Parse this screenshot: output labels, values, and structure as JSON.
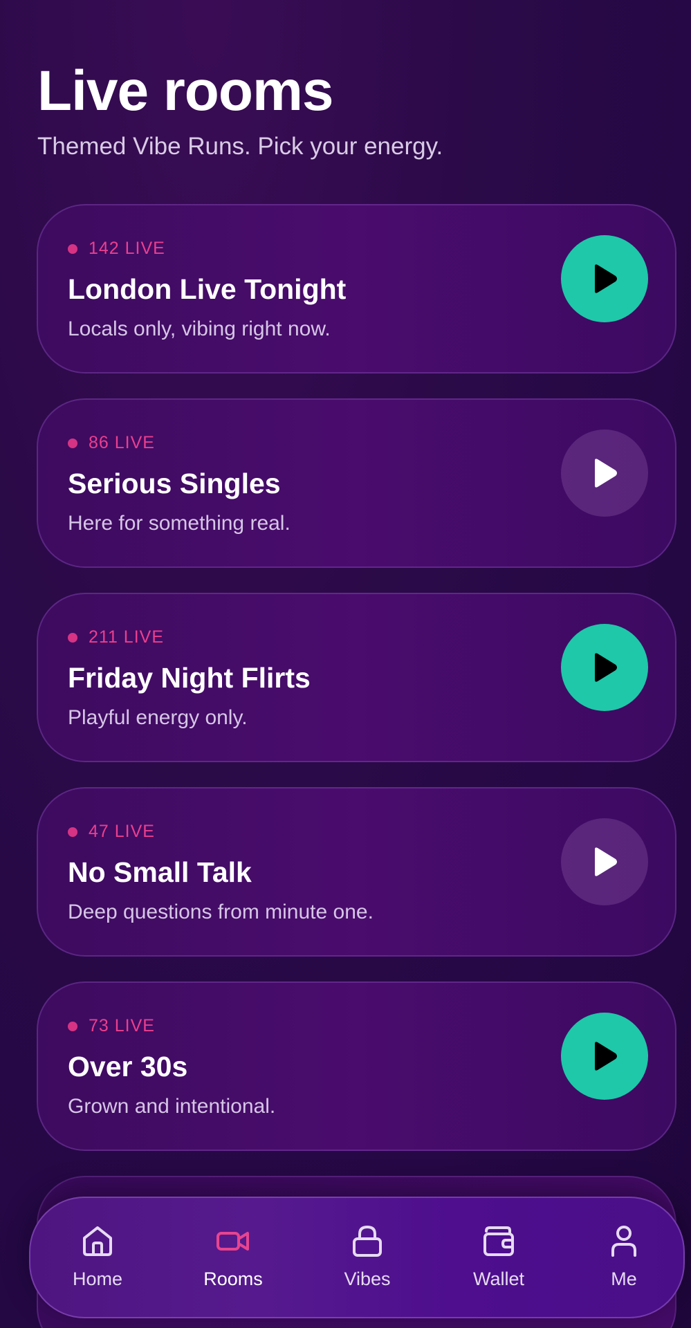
{
  "header": {
    "title": "Live rooms",
    "subtitle": "Themed Vibe Runs. Pick your energy."
  },
  "rooms": [
    {
      "live": "142 LIVE",
      "title": "London Live Tonight",
      "description": "Locals only, vibing right now.",
      "play_state": "active"
    },
    {
      "live": "86 LIVE",
      "title": "Serious Singles",
      "description": "Here for something real.",
      "play_state": "inactive"
    },
    {
      "live": "211 LIVE",
      "title": "Friday Night Flirts",
      "description": "Playful energy only.",
      "play_state": "active"
    },
    {
      "live": "47 LIVE",
      "title": "No Small Talk",
      "description": "Deep questions from minute one.",
      "play_state": "inactive"
    },
    {
      "live": "73 LIVE",
      "title": "Over 30s",
      "description": "Grown and intentional.",
      "play_state": "active"
    }
  ],
  "tabs": [
    {
      "label": "Home",
      "icon": "home-icon",
      "active": false
    },
    {
      "label": "Rooms",
      "icon": "video-camera-icon",
      "active": true
    },
    {
      "label": "Vibes",
      "icon": "lock-icon",
      "active": false
    },
    {
      "label": "Wallet",
      "icon": "wallet-icon",
      "active": false
    },
    {
      "label": "Me",
      "icon": "user-icon",
      "active": false
    }
  ],
  "colors": {
    "accent_teal": "#1ec8a9",
    "live_pink": "#ec3f8e",
    "active_tab_pink": "#e8448f",
    "background": "#2a0a45"
  }
}
